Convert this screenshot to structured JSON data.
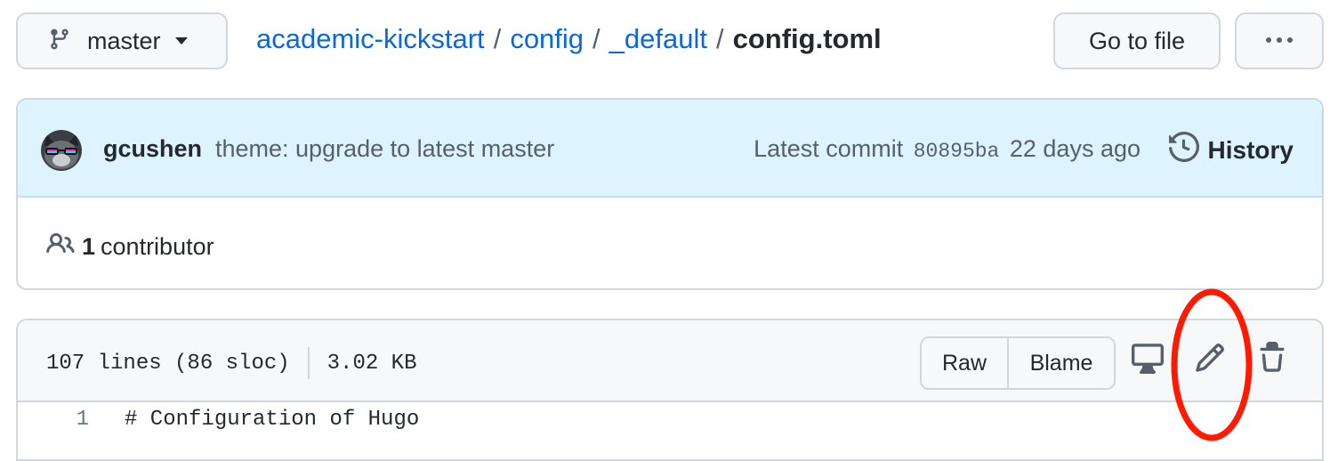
{
  "branch": {
    "label": "master",
    "icon": "git-branch-icon"
  },
  "breadcrumb": {
    "repo": "academic-kickstart",
    "dir1": "config",
    "dir2": "_default",
    "file": "config.toml",
    "separator": "/"
  },
  "actions": {
    "go_to_file": "Go to file",
    "more_icon": "kebab-horizontal-icon"
  },
  "commit": {
    "author": "gcushen",
    "message": "theme: upgrade to latest master",
    "latest_label": "Latest commit",
    "sha": "80895ba",
    "age": "22 days ago",
    "history_label": "History"
  },
  "contributors": {
    "count": "1",
    "label": "contributor"
  },
  "file": {
    "lines": "107 lines (86 sloc)",
    "size": "3.02 KB",
    "raw_label": "Raw",
    "blame_label": "Blame",
    "icons": [
      "desktop-icon",
      "pencil-icon",
      "trash-icon"
    ]
  },
  "code": [
    {
      "num": "1",
      "text": "# Configuration of Hugo"
    }
  ],
  "colors": {
    "link": "#0969da",
    "commit_bg": "#ddf4ff",
    "annotation": "#ff1a00"
  }
}
